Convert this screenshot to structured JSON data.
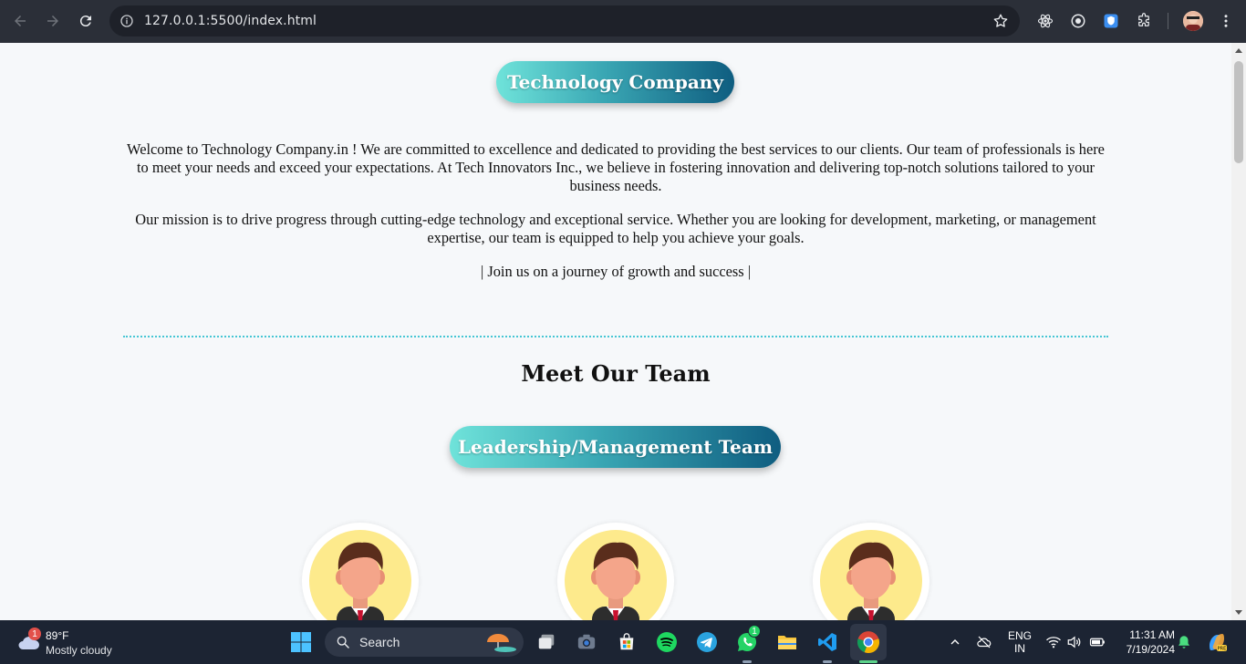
{
  "browser": {
    "url": "127.0.0.1:5500/index.html"
  },
  "page": {
    "company_title": "Technology Company",
    "intro_paragraphs": [
      "Welcome to Technology Company.in ! We are committed to excellence and dedicated to providing the best services to our clients. Our team of professionals is here to meet your needs and exceed your expectations. At Tech Innovators Inc., we believe in fostering innovation and delivering top-notch solutions tailored to your business needs.",
      "Our mission is to drive progress through cutting-edge technology and exceptional service. Whether you are looking for development, marketing, or management expertise, our team is equipped to help you achieve your goals.",
      "| Join us on a journey of growth and success |"
    ],
    "team_heading": "Meet Our Team",
    "leadership_title": "Leadership/Management Team",
    "avatar_count": 3
  },
  "taskbar": {
    "weather_badge": "1",
    "temperature": "89°F",
    "condition": "Mostly cloudy",
    "search_label": "Search",
    "whatsapp_badge": "1",
    "lang_line1": "ENG",
    "lang_line2": "IN",
    "time": "11:31 AM",
    "date": "7/19/2024"
  },
  "colors": {
    "pill_gradient_start": "#6fe3da",
    "pill_gradient_end": "#0f5d80",
    "divider": "#46c6d4",
    "avatar_bg": "#fdea8c"
  }
}
